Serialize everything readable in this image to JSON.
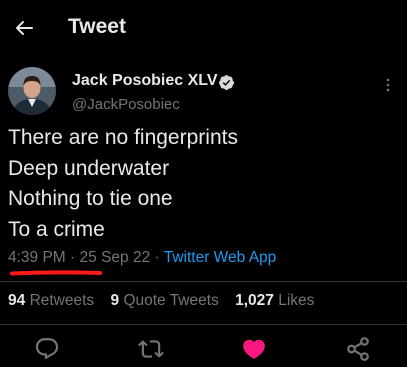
{
  "header": {
    "title": "Tweet",
    "back_icon": "arrow-left-icon"
  },
  "author": {
    "name": "Jack Posobiec XLV",
    "handle": "@JackPosobiec",
    "verified_icon": "verified-badge-icon",
    "verified_color": "#d9d9d9"
  },
  "tweet": {
    "lines": [
      "There are no fingerprints",
      "Deep underwater",
      "Nothing to tie one",
      "To a crime"
    ],
    "time": "4:39 PM",
    "date": "25 Sep 22",
    "source": "Twitter Web App",
    "separator": "·"
  },
  "stats": {
    "retweets_count": "94",
    "retweets_label": "Retweets",
    "quotes_count": "9",
    "quotes_label": "Quote Tweets",
    "likes_count": "1,027",
    "likes_label": "Likes"
  },
  "actions": [
    {
      "name": "reply",
      "icon": "comment-icon"
    },
    {
      "name": "retweet",
      "icon": "retweet-icon"
    },
    {
      "name": "like",
      "icon": "heart-icon",
      "active": true
    },
    {
      "name": "share",
      "icon": "share-icon"
    }
  ],
  "colors": {
    "background": "#000000",
    "text": "#e7e9ea",
    "secondary": "#71767b",
    "link": "#1d9bf0",
    "like": "#f91880",
    "annotation": "#ff1a1a"
  }
}
